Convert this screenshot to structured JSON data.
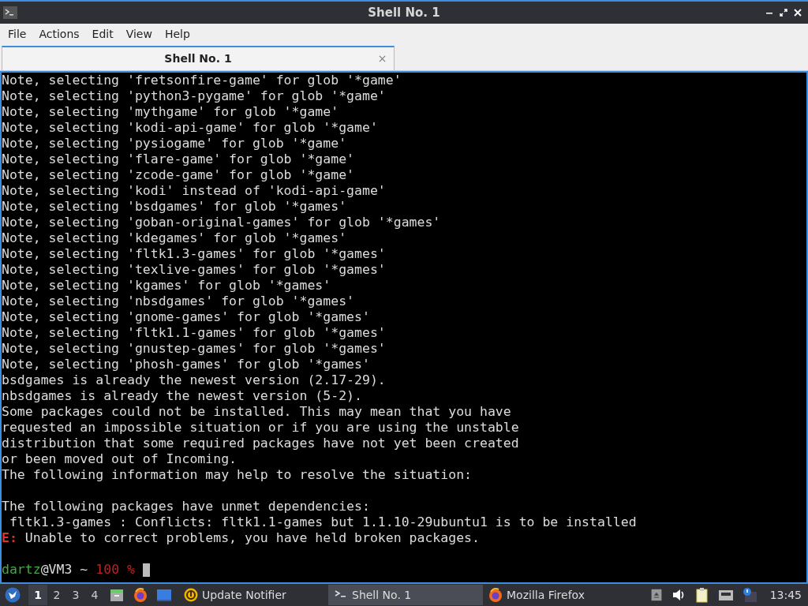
{
  "window": {
    "title": "Shell No. 1"
  },
  "menu": [
    "File",
    "Actions",
    "Edit",
    "View",
    "Help"
  ],
  "tabs": [
    {
      "label": "Shell No. 1",
      "selected": true
    }
  ],
  "terminal": {
    "lines": [
      {
        "kind": "plain",
        "text": "Note, selecting 'fretsonfire-game' for glob '*game'"
      },
      {
        "kind": "plain",
        "text": "Note, selecting 'python3-pygame' for glob '*game'"
      },
      {
        "kind": "plain",
        "text": "Note, selecting 'mythgame' for glob '*game'"
      },
      {
        "kind": "plain",
        "text": "Note, selecting 'kodi-api-game' for glob '*game'"
      },
      {
        "kind": "plain",
        "text": "Note, selecting 'pysiogame' for glob '*game'"
      },
      {
        "kind": "plain",
        "text": "Note, selecting 'flare-game' for glob '*game'"
      },
      {
        "kind": "plain",
        "text": "Note, selecting 'zcode-game' for glob '*game'"
      },
      {
        "kind": "plain",
        "text": "Note, selecting 'kodi' instead of 'kodi-api-game'"
      },
      {
        "kind": "plain",
        "text": "Note, selecting 'bsdgames' for glob '*games'"
      },
      {
        "kind": "plain",
        "text": "Note, selecting 'goban-original-games' for glob '*games'"
      },
      {
        "kind": "plain",
        "text": "Note, selecting 'kdegames' for glob '*games'"
      },
      {
        "kind": "plain",
        "text": "Note, selecting 'fltk1.3-games' for glob '*games'"
      },
      {
        "kind": "plain",
        "text": "Note, selecting 'texlive-games' for glob '*games'"
      },
      {
        "kind": "plain",
        "text": "Note, selecting 'kgames' for glob '*games'"
      },
      {
        "kind": "plain",
        "text": "Note, selecting 'nbsdgames' for glob '*games'"
      },
      {
        "kind": "plain",
        "text": "Note, selecting 'gnome-games' for glob '*games'"
      },
      {
        "kind": "plain",
        "text": "Note, selecting 'fltk1.1-games' for glob '*games'"
      },
      {
        "kind": "plain",
        "text": "Note, selecting 'gnustep-games' for glob '*games'"
      },
      {
        "kind": "plain",
        "text": "Note, selecting 'phosh-games' for glob '*games'"
      },
      {
        "kind": "plain",
        "text": "bsdgames is already the newest version (2.17-29)."
      },
      {
        "kind": "plain",
        "text": "nbsdgames is already the newest version (5-2)."
      },
      {
        "kind": "plain",
        "text": "Some packages could not be installed. This may mean that you have"
      },
      {
        "kind": "plain",
        "text": "requested an impossible situation or if you are using the unstable"
      },
      {
        "kind": "plain",
        "text": "distribution that some required packages have not yet been created"
      },
      {
        "kind": "plain",
        "text": "or been moved out of Incoming."
      },
      {
        "kind": "plain",
        "text": "The following information may help to resolve the situation:"
      },
      {
        "kind": "blank"
      },
      {
        "kind": "plain",
        "text": "The following packages have unmet dependencies:"
      },
      {
        "kind": "plain",
        "text": " fltk1.3-games : Conflicts: fltk1.1-games but 1.1.10-29ubuntu1 is to be installed"
      },
      {
        "kind": "error",
        "label": "E:",
        "text": " Unable to correct problems, you have held broken packages."
      },
      {
        "kind": "blank"
      }
    ],
    "prompt": {
      "user": "dartz",
      "host": "@VM3 ~",
      "status": "100 %"
    }
  },
  "taskbar": {
    "workspaces": [
      {
        "label": "1",
        "selected": true
      },
      {
        "label": "2",
        "selected": false
      },
      {
        "label": "3",
        "selected": false
      },
      {
        "label": "4",
        "selected": false
      }
    ],
    "tasks": [
      {
        "kind": "updater",
        "label": "Update Notifier",
        "selected": false
      },
      {
        "kind": "terminal",
        "label": "Shell No. 1",
        "selected": true
      },
      {
        "kind": "firefox",
        "label": "Mozilla Firefox",
        "selected": false
      }
    ],
    "clock": "13:45"
  }
}
